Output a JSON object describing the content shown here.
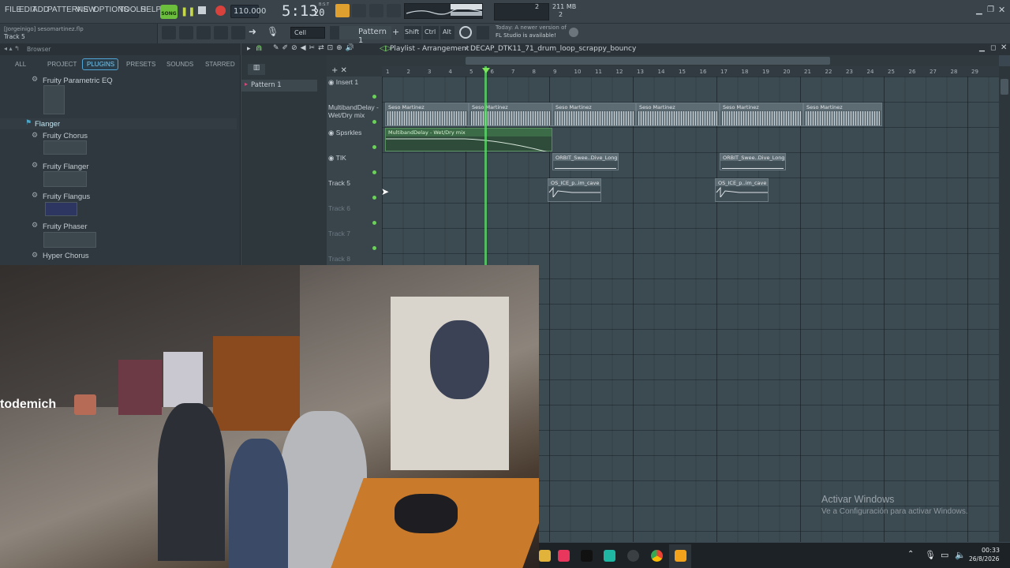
{
  "menu": [
    "FILE",
    "EDIT",
    "ADD",
    "PATTERNS",
    "VIEW",
    "OPTIONS",
    "TOOLS",
    "HELP"
  ],
  "song_label": "SONG",
  "tempo": "110.000",
  "time": "5:13",
  "time_ticks": "20",
  "time_small": "B:S:T",
  "cpu_top": "2",
  "cpu_bottom": "2",
  "memory": "211 MB",
  "hint_user": "[Jorgeinigo] sesomartinez.flp",
  "hint_track": "Track 5",
  "snap": "Cell",
  "pattern_name": "Pattern 1",
  "buttons": {
    "shift": "Shift",
    "ctrl": "Ctrl",
    "alt": "Alt"
  },
  "news": {
    "line1": "Today: A newer version of",
    "line2": "FL Studio is available!"
  },
  "browser": {
    "title": "Browser",
    "tabs": [
      "ALL",
      "PROJECT",
      "PLUGINS",
      "PRESETS",
      "SOUNDS",
      "STARRED"
    ],
    "active_tab": "PLUGINS",
    "items": [
      "Fruity Parametric EQ",
      "Flanger",
      "Fruity Chorus",
      "Fruity Flanger",
      "Fruity Flangus",
      "Fruity Phaser",
      "Hyper Chorus"
    ]
  },
  "pattern_list": [
    "Pattern 1"
  ],
  "playlist": {
    "title": "Playlist - Arrangement",
    "breadcrumb": "DECAP_DTK11_71_drum_loop_scrappy_bouncy",
    "ruler": [
      "1",
      "2",
      "3",
      "4",
      "5",
      "6",
      "7",
      "8",
      "9",
      "10",
      "11",
      "12",
      "13",
      "14",
      "15",
      "16",
      "17",
      "18",
      "19",
      "20",
      "21",
      "22",
      "23",
      "24",
      "25",
      "26",
      "27",
      "28",
      "29"
    ],
    "tracks": [
      "Insert 1",
      "MultibandDelay - Wet/Dry mix",
      "Spsrkles",
      "TIK",
      "Track 5",
      "Track 6",
      "Track 7",
      "Track 8"
    ],
    "clips": {
      "seso": "Seso Martinez",
      "auto": "MultibandDelay - Wet/Dry mix",
      "orbit": "ORBIT_Swee..Dive_Long",
      "ice": "OS_ICE_p..im_cave"
    }
  },
  "stream_name": "todemich",
  "activate": {
    "line1": "Activar Windows",
    "line2": "Ve a Configuración para activar Windows."
  },
  "clock": {
    "time": "00:33",
    "date": "26/8/2026"
  }
}
